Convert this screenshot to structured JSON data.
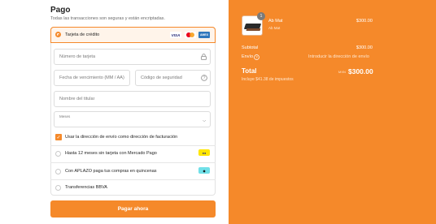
{
  "payment": {
    "title": "Pago",
    "subtitle": "Todas las transacciones son seguras y están encriptadas.",
    "card_option_label": "Tarjeta de crédito",
    "brands": {
      "visa": "VISA",
      "amex": "AMEX"
    },
    "fields": {
      "card_number_placeholder": "Número de tarjeta",
      "expiry_placeholder": "Fecha de vencimiento (MM / AA)",
      "security_code_placeholder": "Código de seguridad",
      "cardholder_placeholder": "Nombre del titular",
      "months_label": "Meses"
    },
    "billing_checkbox_label": "Usar la dirección de envío como dirección de facturación",
    "billing_checked": true,
    "other_methods": [
      {
        "label": "Hasta 12 meses sin tarjeta con Mercado Pago",
        "icon": "mercado-pago-icon"
      },
      {
        "label": "Con APLAZO paga tus compras en quincenas",
        "icon": "aplazo-icon"
      },
      {
        "label": "Transferencias BBVA"
      }
    ],
    "pay_button_label": "Pagar ahora"
  },
  "summary": {
    "item": {
      "name": "Ab Mat",
      "variant": "Ab Mat",
      "price": "$300.00",
      "quantity": "1"
    },
    "subtotal_label": "Subtotal",
    "subtotal_value": "$300.00",
    "shipping_label": "Envío",
    "shipping_value": "Introducir la dirección de envío",
    "total_label": "Total",
    "currency": "MXN",
    "total_value": "$300.00",
    "taxes_note": "Incluye $41.38 de impuestos"
  },
  "colors": {
    "accent": "#f5892a",
    "summary_bg": "#f5892a"
  }
}
